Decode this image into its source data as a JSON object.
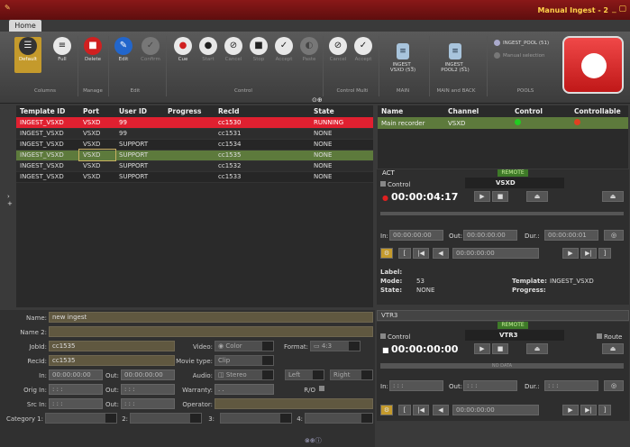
{
  "window": {
    "title": "Manual Ingest - 2",
    "controls": "_ ▢"
  },
  "tabs": {
    "home": "Home"
  },
  "ribbon": {
    "columns": {
      "default": "Default",
      "full": "Full",
      "group": "Columns"
    },
    "manage": {
      "delete": "Delete",
      "group": "Manage"
    },
    "edit": {
      "edit": "Edit",
      "confirm": "Confirm",
      "group": "Edit"
    },
    "control": {
      "cue": "Cue",
      "start": "Start",
      "cancel": "Cancel",
      "stop": "Stop",
      "accept": "Accept",
      "paste": "Paste",
      "group": "Control"
    },
    "control_multi": {
      "cancel": "Cancel",
      "accept": "Accept",
      "group": "Control Multi"
    },
    "main": {
      "label": "INGEST_ VSXD (53)",
      "group": "MAIN"
    },
    "main_backup": {
      "label": "INGEST_ POOL2 (51)",
      "group": "MAIN and BACK"
    },
    "pools": {
      "pool1": "INGEST_POOL (51)",
      "manual": "Manual selection",
      "group": "POOLS"
    }
  },
  "jobs": {
    "headers": [
      "Template ID",
      "Port",
      "User ID",
      "Progress",
      "RecId",
      "State"
    ],
    "rows": [
      [
        "INGEST_VSXD",
        "VSXD",
        "99",
        "",
        "cc1530",
        "RUNNING"
      ],
      [
        "INGEST_VSXD",
        "VSXD",
        "99",
        "",
        "cc1531",
        "NONE"
      ],
      [
        "INGEST_VSXD",
        "VSXD",
        "SUPPORT",
        "",
        "cc1534",
        "NONE"
      ],
      [
        "INGEST_VSXD",
        "VSXD",
        "SUPPORT",
        "",
        "cc1535",
        "NONE"
      ],
      [
        "INGEST_VSXD",
        "VSXD",
        "SUPPORT",
        "",
        "cc1532",
        "NONE"
      ],
      [
        "INGEST_VSXD",
        "VSXD",
        "SUPPORT",
        "",
        "cc1533",
        "NONE"
      ]
    ]
  },
  "channels": {
    "headers": [
      "Name",
      "Channel",
      "Control",
      "Controllable"
    ],
    "rows": [
      {
        "name": "Main recorder",
        "channel": "VSXD",
        "control": "#22cc22",
        "controllable": "#e04020"
      }
    ]
  },
  "form": {
    "name_label": "Name:",
    "name": "new ingest",
    "name2_label": "Name 2:",
    "name2": "",
    "jobid_label": "JobId:",
    "jobid": "cc1535",
    "recid_label": "RecId:",
    "recid": "cc1535",
    "in_label": "In:",
    "in": "00:00:00:00",
    "out_label": "Out:",
    "out": "00:00:00:00",
    "origin_label": "Orig In:",
    "origin": ": : :",
    "origout_label": "Out:",
    "origout": ": : :",
    "srcin_label": "Src In:",
    "srcin": ": : :",
    "srcout_label": "Out:",
    "srcout": ": : :",
    "video_label": "Video:",
    "video": "Color",
    "format_label": "Format:",
    "format": "4:3",
    "movietype_label": "Movie type:",
    "movietype": "Clip",
    "audio_label": "Audio:",
    "audio": "Stereo",
    "left": "Left",
    "right": "Right",
    "warranty_label": "Warranty:",
    "warranty": ". .",
    "ro_label": "R/O",
    "operator_label": "Operator:",
    "cat1_label": "Category 1:",
    "cat2_label": "2:",
    "cat3_label": "3:",
    "cat4_label": "4:"
  },
  "vtr1": {
    "act": "ACT",
    "remote": "REMOTE",
    "control": "Control",
    "device": "VSXD",
    "timecode": "00:00:04:17",
    "in_label": "In:",
    "in": "00:00:00:00",
    "out_label": "Out:",
    "out": "00:00:00:00",
    "dur_label": "Dur.:",
    "dur": "00:00:00:01",
    "goto": "00:00:00:00",
    "label_label": "Label:",
    "mode_label": "Mode:",
    "mode": "53",
    "state_label": "State:",
    "state": "NONE",
    "template_label": "Template:",
    "template": "INGEST_VSXD",
    "progress_label": "Progress:"
  },
  "vtr2": {
    "select": "VTR3",
    "remote": "REMOTE",
    "control": "Control",
    "device": "VTR3",
    "route": "Route",
    "timecode": "00:00:00:00",
    "nodata": "NO DATA",
    "in_label": "In:",
    "in": ": : :",
    "out_label": "Out:",
    "out": ": : :",
    "dur_label": "Dur.:",
    "dur": ": : :",
    "goto": "00:00:00:00"
  }
}
